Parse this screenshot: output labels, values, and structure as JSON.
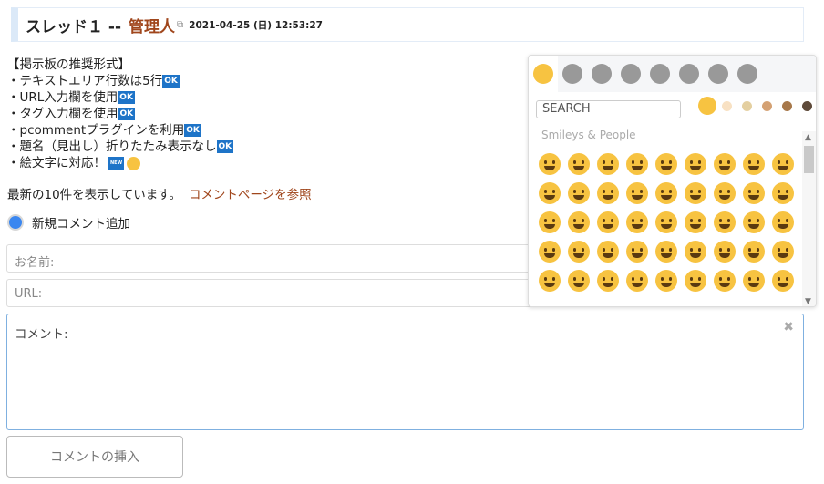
{
  "header": {
    "title": "スレッド１ --",
    "author": "管理人",
    "external_icon": "external-link-icon",
    "datetime": "2021-04-25 (日) 12:53:27"
  },
  "intro": {
    "heading": "【掲示板の推奨形式】",
    "items": [
      {
        "text": "・テキストエリア行数は5行",
        "badge": "OK"
      },
      {
        "text": "・URL入力欄を使用",
        "badge": "OK"
      },
      {
        "text": "・タグ入力欄を使用",
        "badge": "OK"
      },
      {
        "text": "・pcommentプラグインを利用",
        "badge": "OK"
      },
      {
        "text": "・題名（見出し）折りたたみ表示なし",
        "badge": "OK"
      },
      {
        "text": "・絵文字に対応！",
        "badge": "NEW"
      }
    ]
  },
  "recent": {
    "text": "最新の10件を表示しています。",
    "link": "コメントページを参照"
  },
  "radio_label": "新規コメント追加",
  "form": {
    "name_placeholder": "お名前:",
    "url_placeholder": "URL:",
    "comment_placeholder": "コメント:",
    "submit": "コメントの挿入"
  },
  "picker": {
    "tabs": [
      "smileys",
      "animals",
      "food",
      "activity",
      "travel",
      "objects",
      "symbols",
      "flags"
    ],
    "search_placeholder": "SEARCH",
    "skin_tones": [
      "#f7c341",
      "#f8e1c3",
      "#e4cfa0",
      "#d4a173",
      "#a7784a",
      "#5e4a3a"
    ],
    "category": "Smileys & People",
    "emoji_count": 45
  },
  "colors": {
    "accent": "#a0461c",
    "badge": "#1e74c8",
    "focus": "#7fb0e0"
  }
}
